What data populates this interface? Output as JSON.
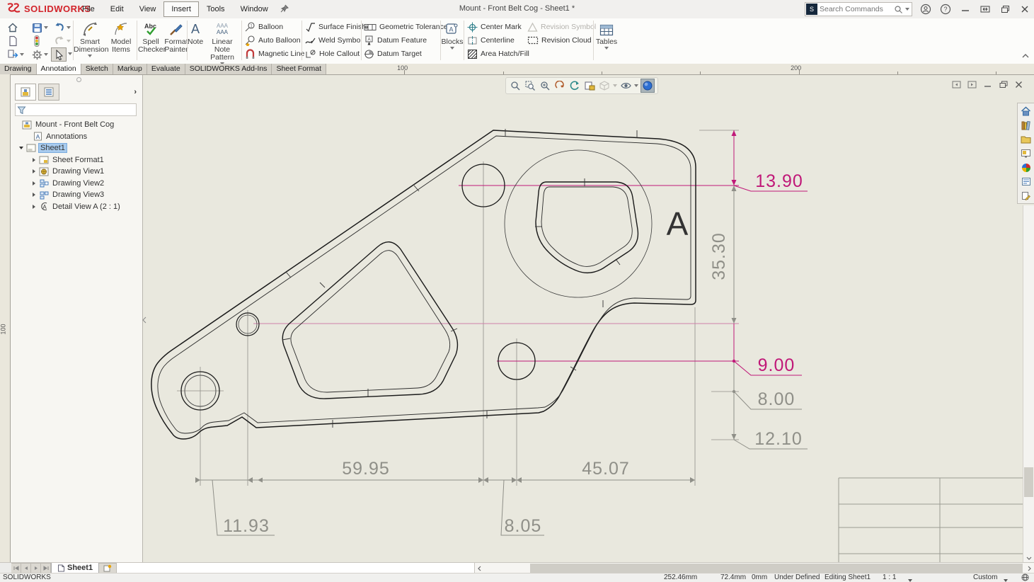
{
  "titlebar": {
    "logo_text": "SOLIDWORKS",
    "menus": [
      "File",
      "Edit",
      "View",
      "Insert",
      "Tools",
      "Window"
    ],
    "active_menu": "Insert",
    "document_title": "Mount - Front Belt Cog - Sheet1 *",
    "search_placeholder": "Search Commands"
  },
  "ribbon": {
    "big_buttons": [
      {
        "label": "Smart Dimension"
      },
      {
        "label": "Model Items"
      },
      {
        "label": "Spell Checker"
      },
      {
        "label": "Format Painter"
      },
      {
        "label": "Note"
      },
      {
        "label": "Linear Note Pattern"
      },
      {
        "label": "Blocks"
      },
      {
        "label": "Tables"
      }
    ],
    "small_buttons": [
      {
        "label": "Balloon"
      },
      {
        "label": "Auto Balloon"
      },
      {
        "label": "Magnetic Line"
      },
      {
        "label": "Surface Finish"
      },
      {
        "label": "Weld Symbol"
      },
      {
        "label": "Hole Callout"
      },
      {
        "label": "Geometric Tolerance"
      },
      {
        "label": "Datum Feature"
      },
      {
        "label": "Datum Target"
      },
      {
        "label": "Center Mark"
      },
      {
        "label": "Centerline"
      },
      {
        "label": "Area Hatch/Fill"
      },
      {
        "label": "Revision Symbol"
      },
      {
        "label": "Revision Cloud"
      }
    ]
  },
  "tabs": {
    "items": [
      "Drawing",
      "Annotation",
      "Sketch",
      "Markup",
      "Evaluate",
      "SOLIDWORKS Add-Ins",
      "Sheet Format"
    ],
    "active": "Annotation"
  },
  "rulers": {
    "top_100": "100",
    "top_200": "200",
    "left_100": "100"
  },
  "feature_tree": {
    "root": "Mount - Front Belt Cog",
    "items": [
      {
        "label": "Annotations"
      },
      {
        "label": "Sheet1",
        "selected": true
      },
      {
        "label": "Sheet Format1"
      },
      {
        "label": "Drawing View1"
      },
      {
        "label": "Drawing View2"
      },
      {
        "label": "Drawing View3"
      },
      {
        "label": "Detail View A (2 : 1)"
      }
    ]
  },
  "drawing": {
    "detail_label": "A",
    "dimensions": {
      "d13_90": "13.90",
      "d35_30": "35.30",
      "d9_00": "9.00",
      "d8_00": "8.00",
      "d12_10": "12.10",
      "d59_95": "59.95",
      "d45_07": "45.07",
      "d11_93": "11.93",
      "d8_05": "8.05"
    },
    "colors": {
      "selected_dimension": "#c01878",
      "dimension_gray": "#8f8f88",
      "edge": "#1a1a1a",
      "sheet": "#e9e8de"
    }
  },
  "sheet_bar": {
    "sheet_tab": "Sheet1"
  },
  "statusbar": {
    "app": "SOLIDWORKS",
    "x": "252.46mm",
    "y": "72.4mm",
    "z": "0mm",
    "state": "Under Defined",
    "editing": "Editing Sheet1",
    "scale": "1 : 1",
    "units": "Custom"
  }
}
